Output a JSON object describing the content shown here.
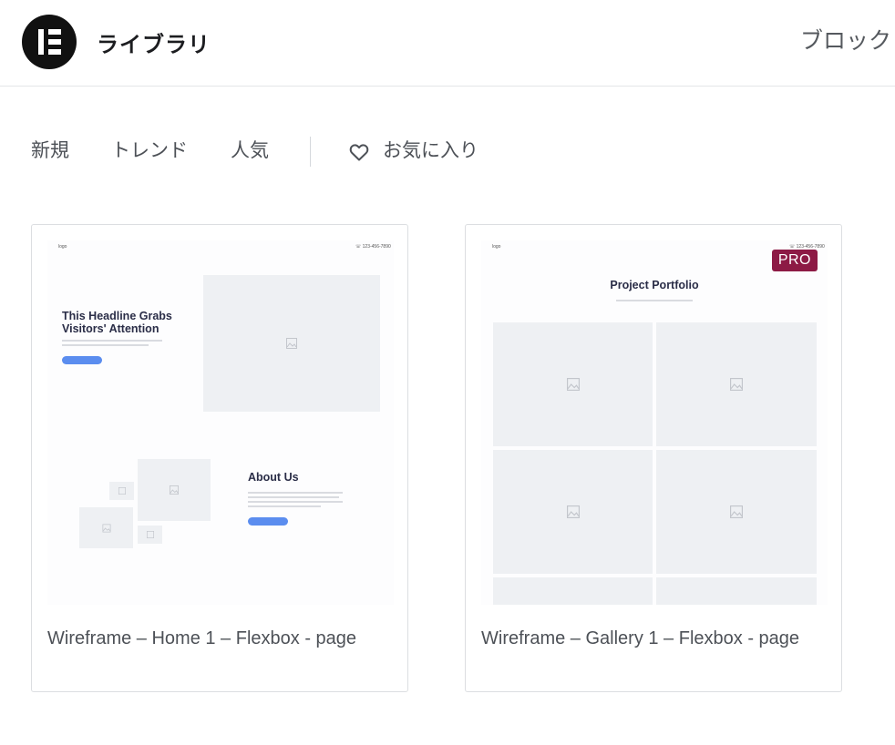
{
  "header": {
    "title": "ライブラリ",
    "tab_blocks": "ブロック",
    "logo_icon": "elementor-logo-icon"
  },
  "filters": {
    "items": [
      "新規",
      "トレンド",
      "人気"
    ],
    "favorites": "お気に入り",
    "favorites_icon": "heart-icon"
  },
  "cards": [
    {
      "title": "Wireframe – Home 1 – Flexbox - page",
      "preview": {
        "logo": "logo",
        "phone": "☏ 123-456-7890",
        "headline": "This Headline Grabs Visitors' Attention",
        "about": "About Us"
      }
    },
    {
      "title": "Wireframe – Gallery 1 – Flexbox - page",
      "badge": "PRO",
      "preview": {
        "logo": "logo",
        "phone": "☏ 123-456-7890",
        "headline": "Project Portfolio"
      }
    }
  ],
  "colors": {
    "pro_badge": "#8d1a45",
    "wireframe_button": "#5b8def"
  }
}
